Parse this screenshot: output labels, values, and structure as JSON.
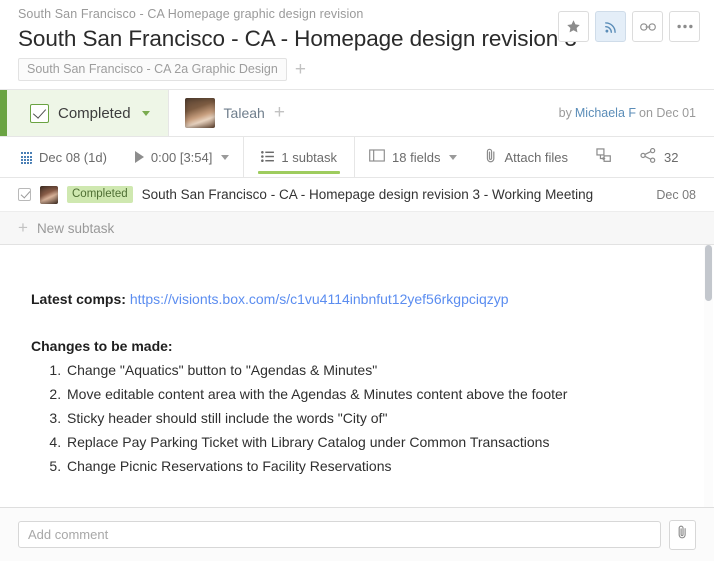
{
  "header": {
    "breadcrumb": "South San Francisco - CA Homepage graphic design revision",
    "title": "South San Francisco - CA - Homepage design revision 3",
    "tag": "South San Francisco - CA 2a Graphic Design",
    "add_tag_label": "+",
    "actions": [
      {
        "name": "star-icon",
        "label": "Star",
        "active": false
      },
      {
        "name": "rss-follow-icon",
        "label": "Follow",
        "active": true
      },
      {
        "name": "link-icon",
        "label": "Copy link",
        "active": false
      },
      {
        "name": "more-icon",
        "label": "More",
        "active": false
      }
    ]
  },
  "status": {
    "state_label": "Completed",
    "assignee": "Taleah",
    "add_assignee_label": "+",
    "credit_prefix": "by",
    "credit_user": "Michaela F",
    "credit_suffix": "on Dec 01"
  },
  "toolbar": {
    "due_date": "Dec 08 (1d)",
    "timer": "0:00 [3:54]",
    "subtasks_tab": "1 subtask",
    "fields": "18 fields",
    "attach": "Attach files",
    "share_count": "32"
  },
  "subtasks": {
    "rows": [
      {
        "badge": "Completed",
        "title": "South San Francisco - CA - Homepage design revision 3 - Working Meeting",
        "date": "Dec 08"
      }
    ],
    "new_subtask_label": "New subtask",
    "new_subtask_plus": "+"
  },
  "body": {
    "comps_label": "Latest comps:",
    "comps_url": "https://visionts.box.com/s/c1vu4114inbnfut12yef56rkgpciqzyp",
    "changes_heading": "Changes to be made:",
    "changes": [
      "Change \"Aquatics\" button to \"Agendas & Minutes\"",
      "Move editable content area with the Agendas & Minutes content above the footer",
      "Sticky header should still include the words \"City of\"",
      "Replace Pay Parking Ticket with Library Catalog under Common Transactions",
      "Change Picnic Reservations to Facility Reservations"
    ]
  },
  "comment": {
    "placeholder": "Add comment",
    "value": ""
  },
  "colors": {
    "green_accent": "#6aa342",
    "green_tab_underline": "#9ecc5e",
    "green_panel_bg": "#eef6e7",
    "badge_bg": "#cfe8b0",
    "link_blue": "#5b8df0",
    "user_link_blue": "#5b8db8",
    "active_btn_bg": "#e4eef8"
  }
}
